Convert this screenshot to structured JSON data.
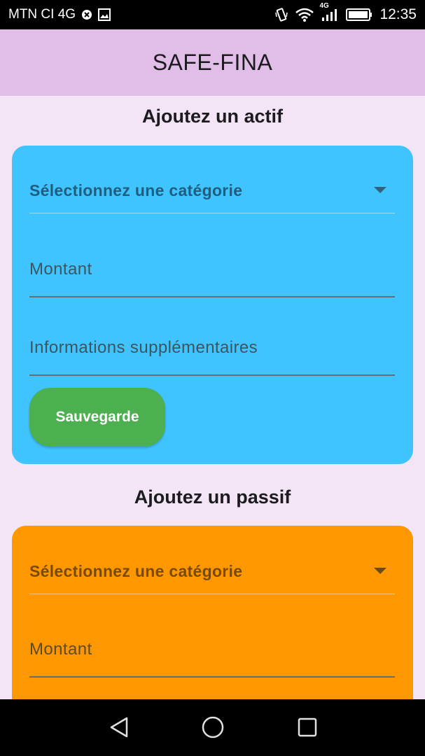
{
  "status_bar": {
    "carrier": "MTN CI 4G",
    "network_label": "4G",
    "time": "12:35"
  },
  "app_bar": {
    "title": "SAFE-FINA"
  },
  "asset_section": {
    "title": "Ajoutez un actif",
    "category_dropdown": "Sélectionnez une catégorie",
    "amount_placeholder": "Montant",
    "info_placeholder": "Informations supplémentaires",
    "save_label": "Sauvegarde",
    "card_color": "#40c4ff"
  },
  "liability_section": {
    "title": "Ajoutez un passif",
    "category_dropdown": "Sélectionnez une catégorie",
    "amount_placeholder": "Montant",
    "card_color": "#ff9800"
  },
  "colors": {
    "app_bar": "#e1bee7",
    "background": "#f3e5f5",
    "save_button": "#4caf50"
  },
  "icons": {
    "status": [
      "blocked-icon",
      "image-icon",
      "vibrate-icon",
      "wifi-icon",
      "signal-icon",
      "battery-icon"
    ],
    "nav": [
      "back-icon",
      "home-icon",
      "recents-icon"
    ]
  }
}
